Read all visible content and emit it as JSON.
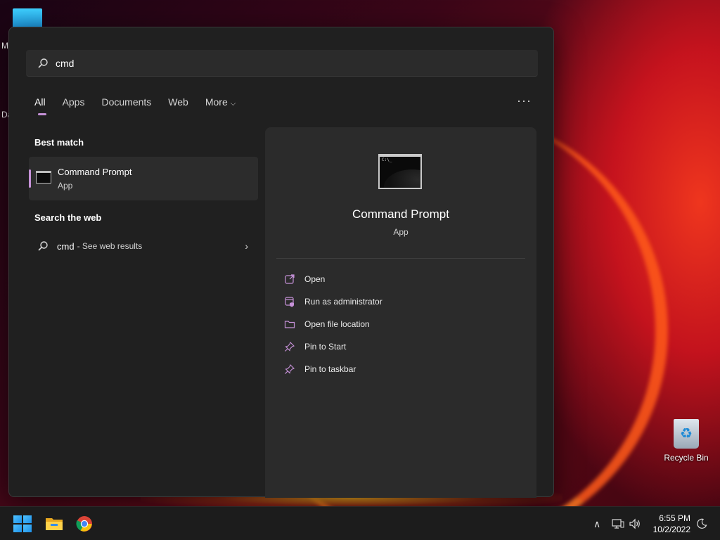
{
  "desktop": {
    "fragment_top": "M",
    "fragment_mid": "Da",
    "recycle_bin_label": "Recycle Bin"
  },
  "search": {
    "value": "cmd"
  },
  "tabs": [
    {
      "label": "All",
      "active": true
    },
    {
      "label": "Apps"
    },
    {
      "label": "Documents"
    },
    {
      "label": "Web"
    },
    {
      "label": "More"
    }
  ],
  "more_options_glyph": "···",
  "best_match": {
    "heading": "Best match",
    "title": "Command Prompt",
    "subtitle": "App"
  },
  "web": {
    "heading": "Search the web",
    "query": "cmd",
    "hint": "- See web results"
  },
  "preview": {
    "title": "Command Prompt",
    "subtitle": "App",
    "actions": [
      {
        "label": "Open",
        "icon": "open-external-icon"
      },
      {
        "label": "Run as administrator",
        "icon": "admin-shield-icon"
      },
      {
        "label": "Open file location",
        "icon": "folder-icon"
      },
      {
        "label": "Pin to Start",
        "icon": "pin-icon"
      },
      {
        "label": "Pin to taskbar",
        "icon": "pin-icon"
      }
    ]
  },
  "taskbar": {
    "time": "6:55 PM",
    "date": "10/2/2022"
  },
  "colors": {
    "accent": "#c792d9",
    "panel": "#202020",
    "preview": "#2b2b2b"
  }
}
